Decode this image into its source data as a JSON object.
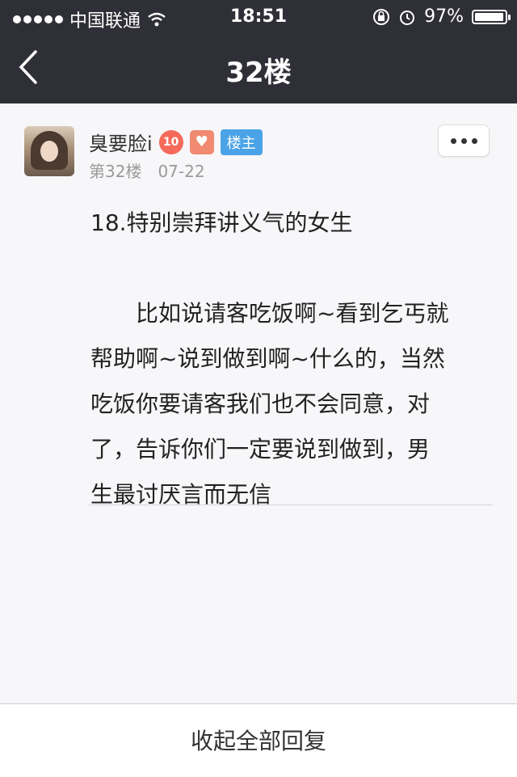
{
  "status_bar": {
    "carrier": "中国联通",
    "time": "18:51",
    "battery_percent": "97%",
    "battery_level": 0.97
  },
  "nav": {
    "title": "32楼"
  },
  "post": {
    "username": "臭要脸i",
    "level": "10",
    "owner_badge": "楼主",
    "floor": "第32楼",
    "date": "07-22",
    "title": "18.特别崇拜讲义气的女生",
    "body_lines": [
      "　　比如说请客吃饭啊~看到乞丐就",
      "帮助啊~说到做到啊~什么的，当然",
      "吃饭你要请客我们也不会同意，对",
      "了，告诉你们一定要说到做到，男",
      "生最讨厌言而无信"
    ]
  },
  "footer": {
    "collapse_label": "收起全部回复"
  }
}
